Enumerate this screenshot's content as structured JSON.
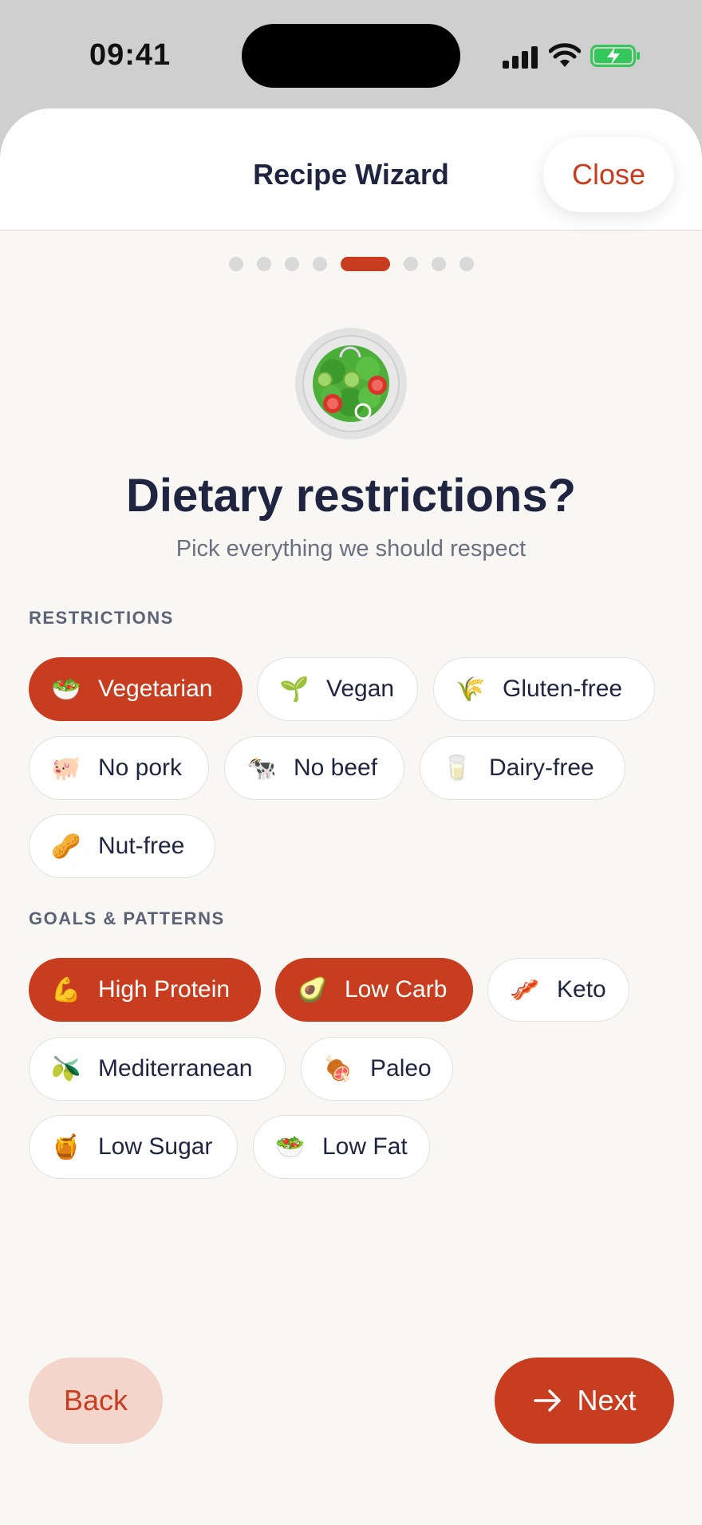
{
  "status": {
    "time": "09:41",
    "battery_color": "#34c759"
  },
  "header": {
    "title": "Recipe Wizard",
    "close_label": "Close"
  },
  "progress": {
    "total_steps": 8,
    "current_step": 5
  },
  "hero": {
    "icon": "salad-icon",
    "title": "Dietary restrictions?",
    "subtitle": "Pick everything we should respect"
  },
  "restrictions": {
    "label": "RESTRICTIONS",
    "items": [
      {
        "label": "Vegetarian",
        "emoji": "🥗",
        "icon": "salad-icon",
        "selected": true
      },
      {
        "label": "Vegan",
        "emoji": "🌱",
        "icon": "seedling-icon",
        "selected": false
      },
      {
        "label": "Gluten-free",
        "emoji": "🌾",
        "icon": "wheat-icon",
        "selected": false
      },
      {
        "label": "No pork",
        "emoji": "🐖",
        "icon": "pig-icon",
        "selected": false
      },
      {
        "label": "No beef",
        "emoji": "🐄",
        "icon": "cow-icon",
        "selected": false
      },
      {
        "label": "Dairy-free",
        "emoji": "🥛",
        "icon": "milk-icon",
        "selected": false
      },
      {
        "label": "Nut-free",
        "emoji": "🥜",
        "icon": "peanut-icon",
        "selected": false
      }
    ]
  },
  "goals": {
    "label": "GOALS & PATTERNS",
    "items": [
      {
        "label": "High Protein",
        "emoji": "💪",
        "icon": "flexed-biceps-icon",
        "selected": true
      },
      {
        "label": "Low Carb",
        "emoji": "🥑",
        "icon": "avocado-icon",
        "selected": true
      },
      {
        "label": "Keto",
        "emoji": "🥓",
        "icon": "bacon-icon",
        "selected": false
      },
      {
        "label": "Mediterranean",
        "emoji": "🫒",
        "icon": "olive-icon",
        "selected": false
      },
      {
        "label": "Paleo",
        "emoji": "🍖",
        "icon": "meat-on-bone-icon",
        "selected": false
      },
      {
        "label": "Low Sugar",
        "emoji": "🍯",
        "icon": "honey-pot-icon",
        "selected": false
      },
      {
        "label": "Low Fat",
        "emoji": "🥗",
        "icon": "salad-icon",
        "selected": false
      }
    ]
  },
  "footer": {
    "back_label": "Back",
    "next_label": "Next",
    "next_icon": "arrow-right-icon"
  },
  "colors": {
    "accent": "#c83d1f",
    "back_bg": "#f3d5cc",
    "text_dark": "#1f2540",
    "sheet_bg": "#f8f7f4"
  }
}
